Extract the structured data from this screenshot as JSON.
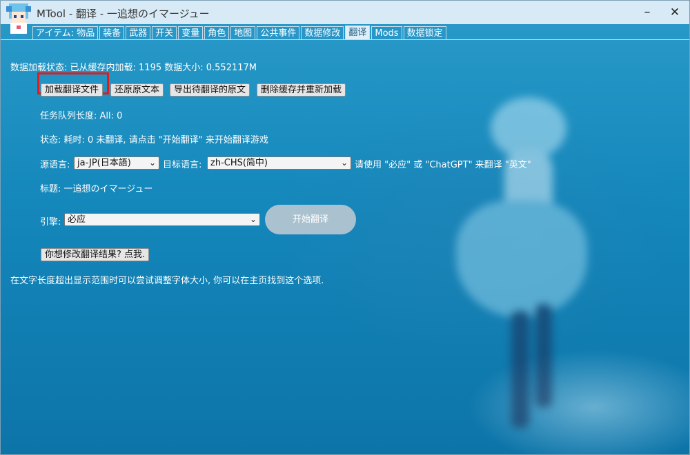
{
  "window": {
    "title": "MTool - 翻译 - 一追想のイマージュー",
    "minimize": "–",
    "close": "✕"
  },
  "tabs": [
    "アイテム: 物品",
    "装备",
    "武器",
    "开关",
    "变量",
    "角色",
    "地图",
    "公共事件",
    "数据修改",
    "翻译",
    "Mods",
    "数据锁定"
  ],
  "translate": {
    "load_status": "数据加载状态: 已从缓存内加载: 1195 数据大小: 0.552117M",
    "buttons": {
      "load_file": "加载翻译文件",
      "restore": "还原原文本",
      "export": "导出待翻译的原文",
      "delete_cache": "删除缓存并重新加载"
    },
    "queue_length": "任务队列长度: All: 0",
    "status": "状态: 耗时: 0 未翻译, 请点击 \"开始翻译\" 来开始翻译游戏",
    "source_lang_label": "源语言:",
    "source_lang_value": "ja-JP(日本語)",
    "target_lang_label": "目标语言:",
    "target_lang_value": "zh-CHS(简中)",
    "lang_hint": "请使用 \"必应\" 或 \"ChatGPT\" 来翻译 \"英文\"",
    "game_title": "标题: 一追想のイマージュー",
    "engine_label": "引擎:",
    "engine_value": "必应",
    "start_button": "开始翻译",
    "modify_button": "你想修改翻译结果? 点我.",
    "tip": "在文字长度超出显示范围时可以尝试调整字体大小, 你可以在主页找到这个选项."
  },
  "active_tab": "翻译"
}
